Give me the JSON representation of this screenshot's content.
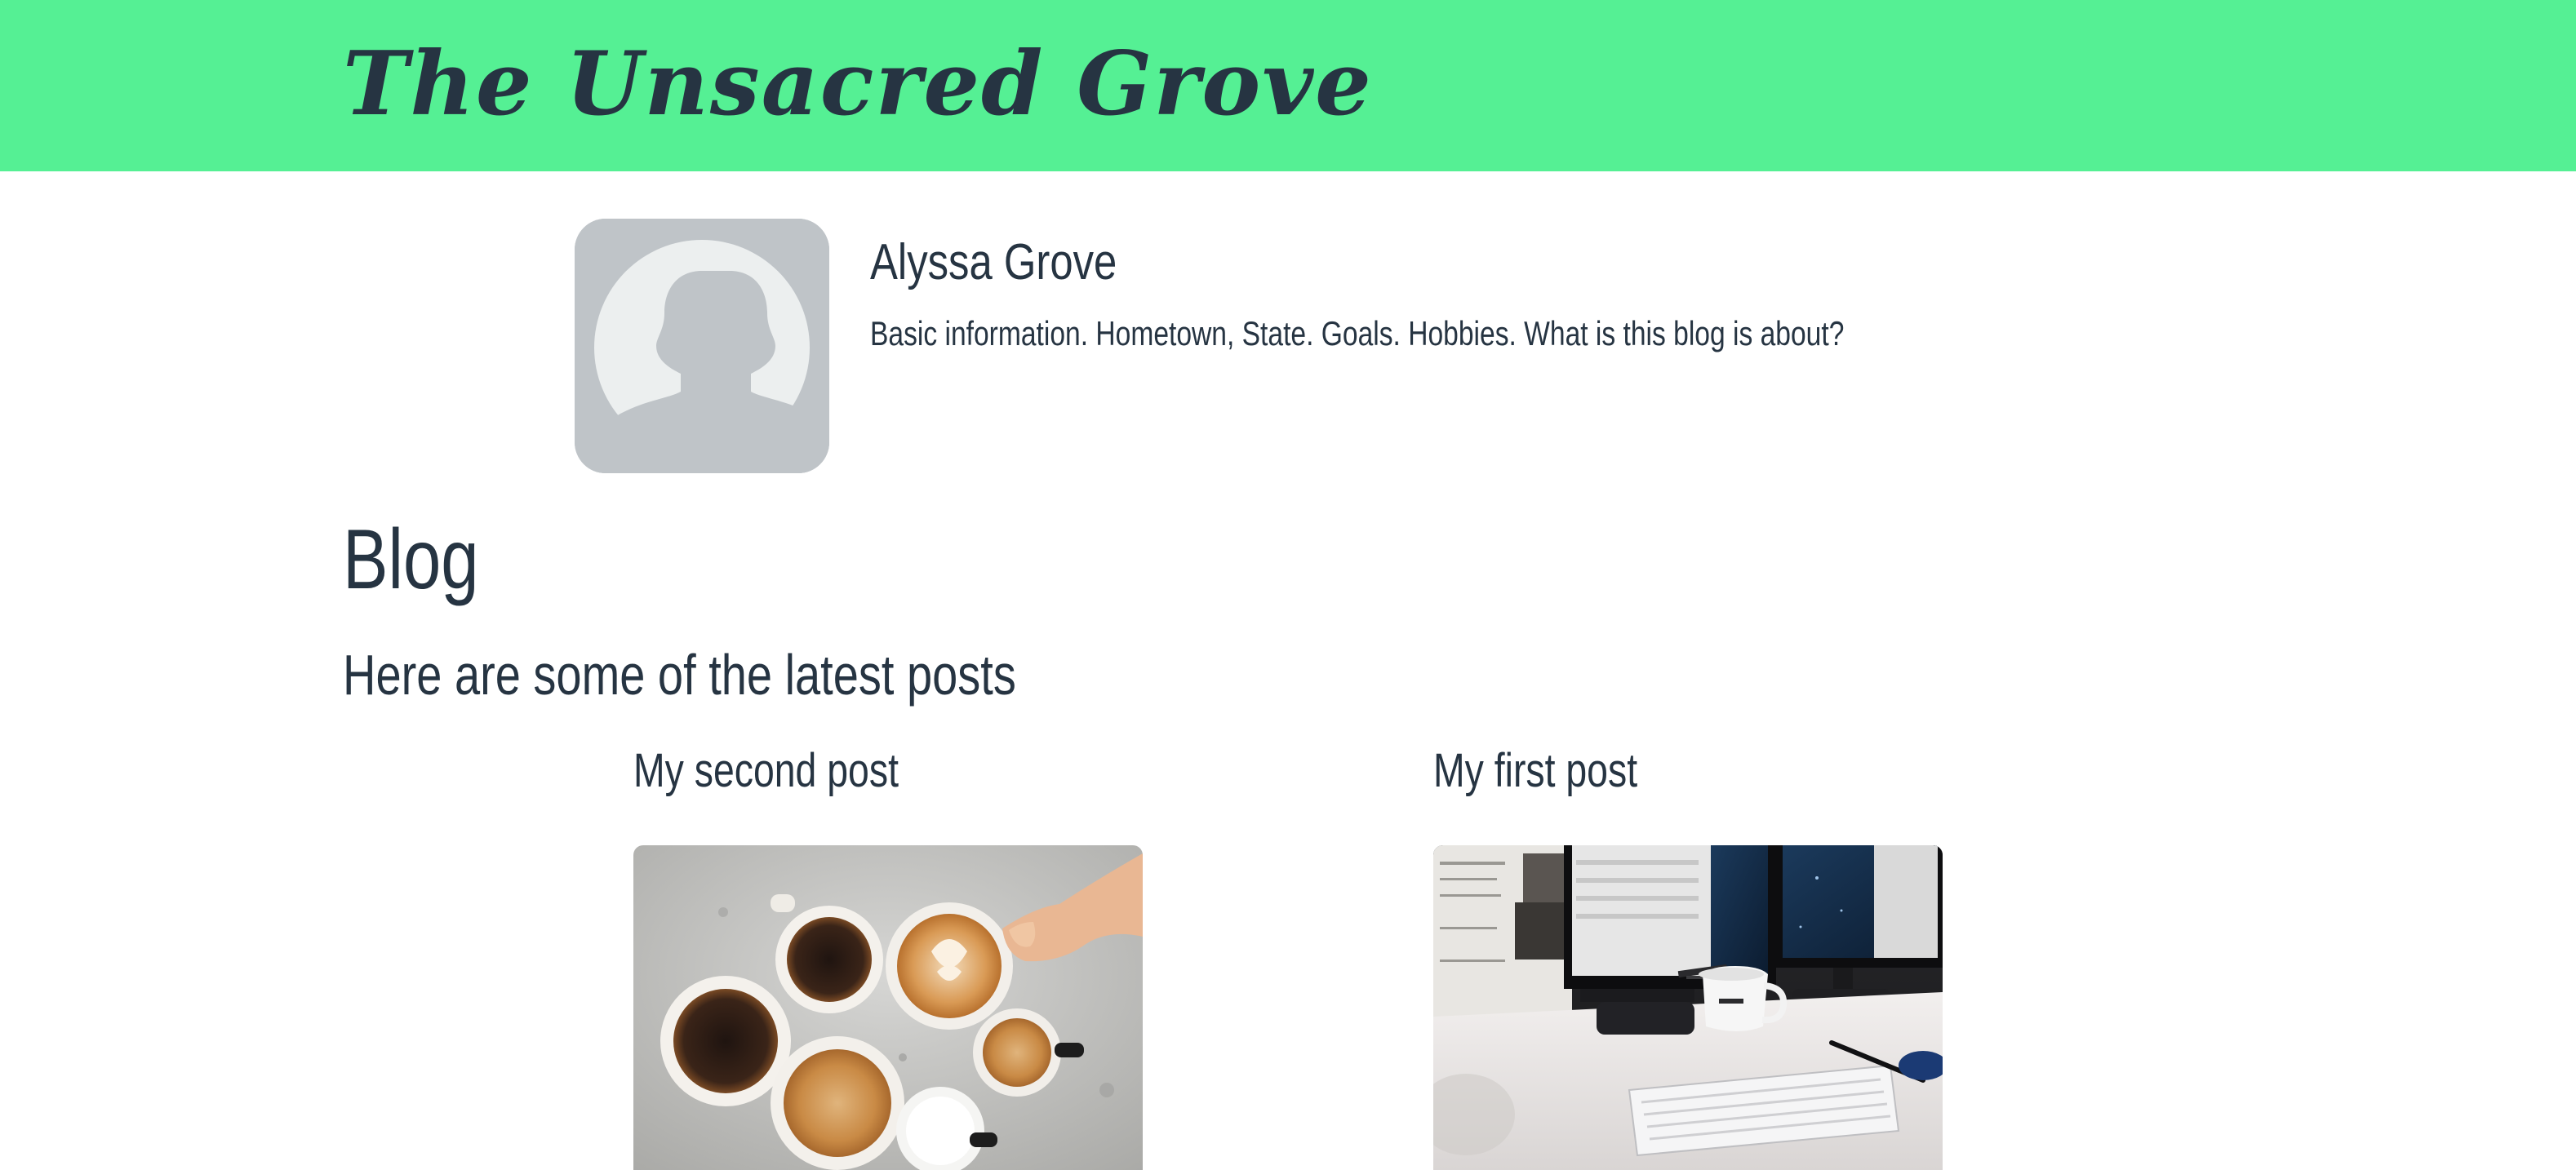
{
  "header": {
    "site_title": "The Unsacred Grove",
    "background": "#55f094"
  },
  "profile": {
    "name": "Alyssa Grove",
    "bio": "Basic information. Hometown, State. Goals. Hobbies. What is this blog is about?",
    "avatar_icon": "user-silhouette-icon"
  },
  "blog": {
    "heading": "Blog",
    "subheading": "Here are some of the latest posts",
    "posts": [
      {
        "title": "My second post",
        "image": "coffee-cups-photo"
      },
      {
        "title": "My first post",
        "image": "desk-monitors-photo"
      }
    ]
  },
  "colors": {
    "text": "#263442",
    "accent": "#55f094",
    "avatar_bg": "#bfc4c8"
  }
}
